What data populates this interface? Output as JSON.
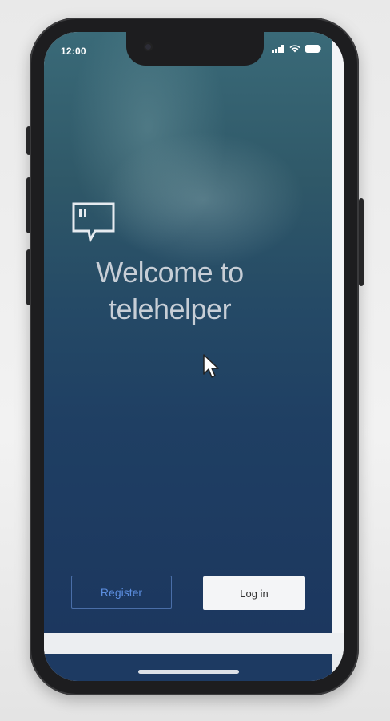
{
  "status_bar": {
    "time": "12:00",
    "icons": [
      "cellular-signal-icon",
      "wifi-icon",
      "battery-icon"
    ]
  },
  "app": {
    "logo_icon": "chat-bubble-icon",
    "welcome_title_line1": "Welcome to",
    "welcome_title_line2": "telehelper",
    "register_label": "Register",
    "login_label": "Log in"
  },
  "colors": {
    "background_top": "#3a6a78",
    "background_bottom": "#1c375f",
    "register_text": "#5c8ee0",
    "register_border": "#4a6ea8",
    "login_background": "#f4f5f7"
  }
}
